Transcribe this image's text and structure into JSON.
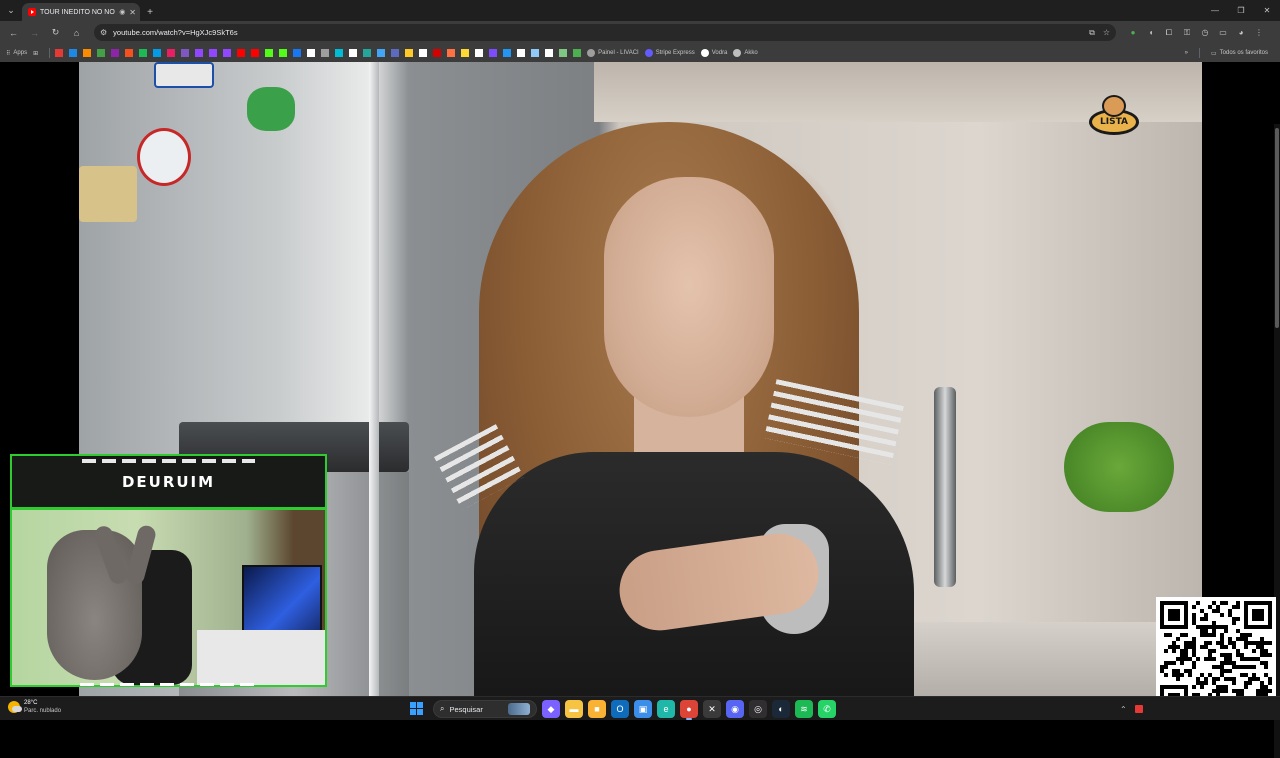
{
  "tabs": [
    {
      "title": "TOUR INÉDITO NO NOVO AP",
      "favicon": "youtube-icon",
      "playing_audio": true
    }
  ],
  "toolbar": {
    "url": "youtube.com/watch?v=HgXJc9SkT6s"
  },
  "bookmarks": {
    "apps_label": "Apps",
    "labeled": [
      {
        "label": "Painel - LIVACI",
        "color": "#9e9e9e"
      },
      {
        "label": "Stripe Express",
        "color": "#635bff"
      },
      {
        "label": "Vodra",
        "color": "#ffffff"
      },
      {
        "label": "Akko",
        "color": "#bdbdbd"
      }
    ],
    "all_bookmarks_label": "Todos os favoritos",
    "icon_colors": [
      "#e53935",
      "#1e88e5",
      "#fb8c00",
      "#43a047",
      "#8e24aa",
      "#f4511e",
      "#1db954",
      "#039be5",
      "#e91e63",
      "#7e57c2",
      "#9146ff",
      "#9146ff",
      "#9146ff",
      "#ff0000",
      "#ff0000",
      "#53fc18",
      "#53fc18",
      "#1877f2",
      "#ffffff",
      "#9e9e9e",
      "#00bcd4",
      "#ffffff",
      "#26a69a",
      "#42a5f5",
      "#5c6bc0",
      "#ffca28",
      "#ffffff",
      "#d50000",
      "#ff7043",
      "#fdd835",
      "#ffffff",
      "#7c4dff",
      "#2196f3",
      "#ffffff",
      "#90caf9",
      "#ffffff",
      "#81c784",
      "#4caf50"
    ]
  },
  "webcam": {
    "streamer_name": "DEURUIM"
  },
  "channel_logo_text": "LISTA",
  "taskbar": {
    "weather_temp": "28°C",
    "weather_condition": "Parc. nublado",
    "search_placeholder": "Pesquisar",
    "apps": [
      {
        "name": "copilot-icon",
        "color": "#7b61ff",
        "glyph": "◆"
      },
      {
        "name": "file-explorer-icon",
        "color": "#f6c343",
        "glyph": "▬"
      },
      {
        "name": "folder-icon",
        "color": "#f9b233",
        "glyph": "■"
      },
      {
        "name": "outlook-icon",
        "color": "#0f6cbd",
        "glyph": "O"
      },
      {
        "name": "store-icon",
        "color": "#3b8eea",
        "glyph": "▣"
      },
      {
        "name": "edge-icon",
        "color": "#1fb7a8",
        "glyph": "e"
      },
      {
        "name": "chrome-icon",
        "color": "#db4437",
        "glyph": "●"
      },
      {
        "name": "code-icon",
        "color": "#3a3a3a",
        "glyph": "✕"
      },
      {
        "name": "discord-icon",
        "color": "#5865f2",
        "glyph": "◉"
      },
      {
        "name": "obs-icon",
        "color": "#302e31",
        "glyph": "◎"
      },
      {
        "name": "steam-icon",
        "color": "#1b2838",
        "glyph": "◐"
      },
      {
        "name": "spotify-icon",
        "color": "#1db954",
        "glyph": "≋"
      },
      {
        "name": "whatsapp-icon",
        "color": "#25d366",
        "glyph": "✆"
      }
    ],
    "active_apps": [
      "chrome-icon"
    ]
  }
}
